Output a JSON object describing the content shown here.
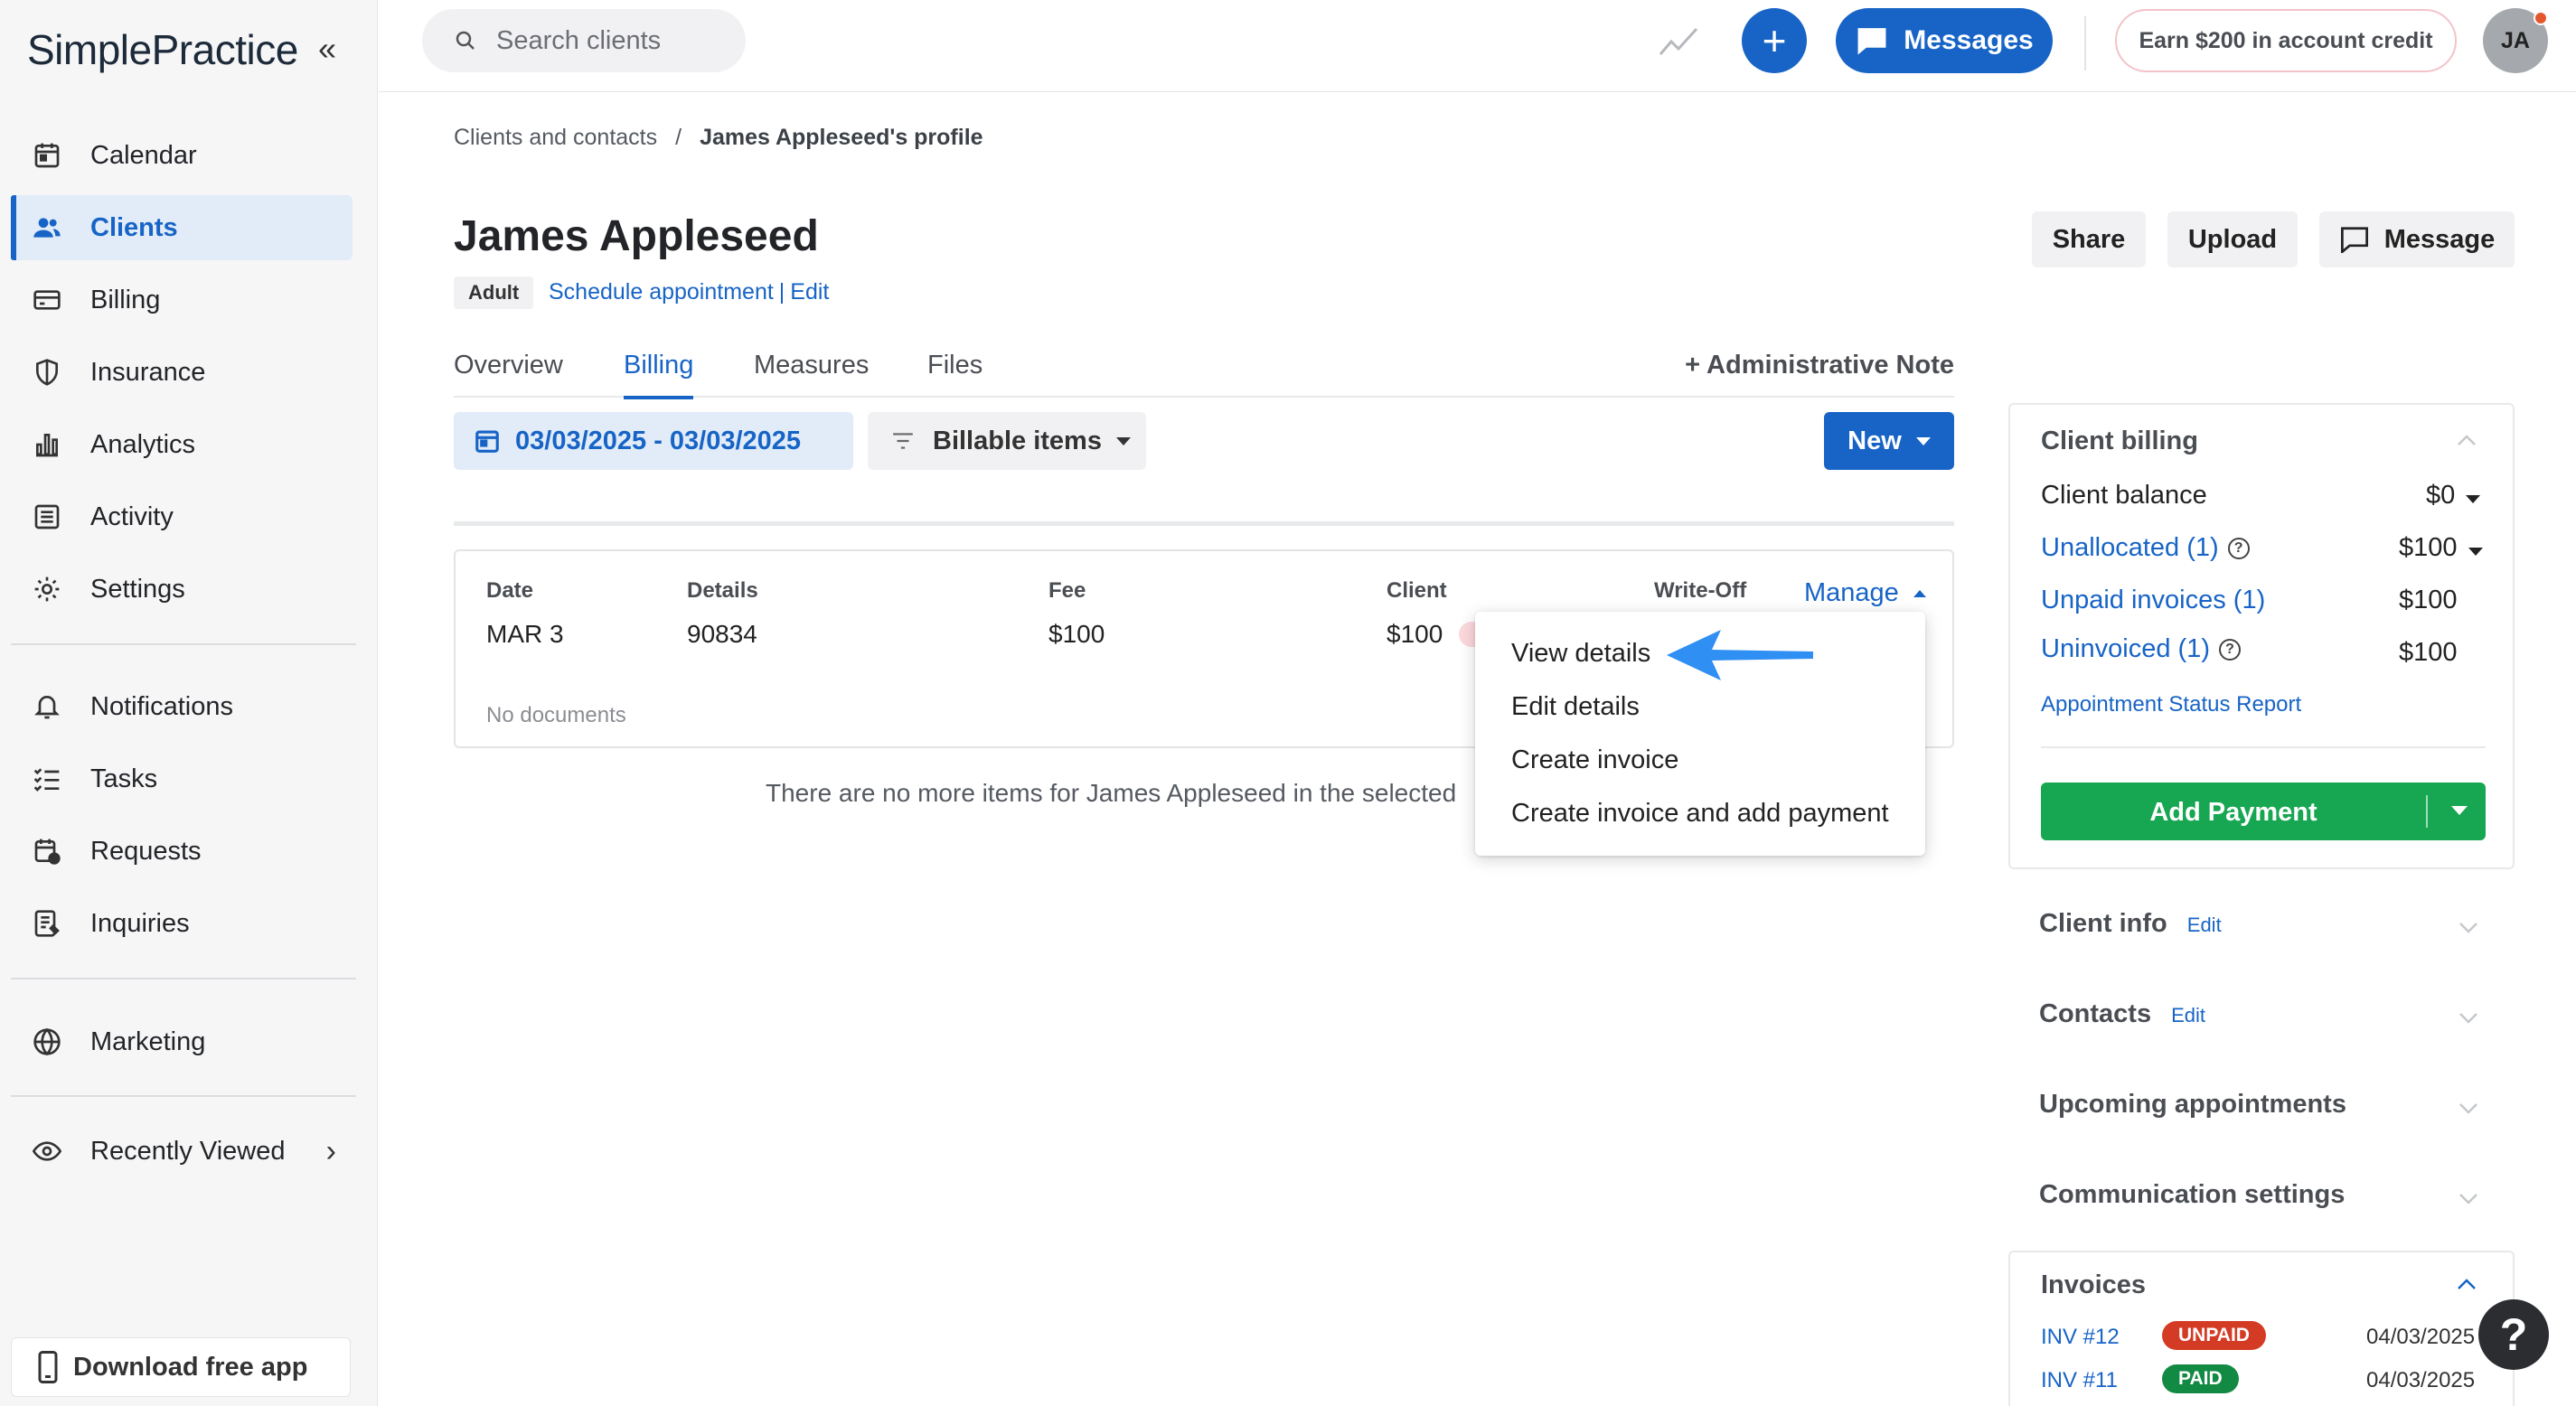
{
  "app": {
    "logo_text": "SimplePractice",
    "collapse_icon": "double-chevron-left-icon"
  },
  "sidebar": {
    "items": [
      {
        "label": "Calendar",
        "icon": "calendar-icon",
        "active": false
      },
      {
        "label": "Clients",
        "icon": "users-icon",
        "active": true
      },
      {
        "label": "Billing",
        "icon": "credit-card-icon",
        "active": false
      },
      {
        "label": "Insurance",
        "icon": "shield-icon",
        "active": false
      },
      {
        "label": "Analytics",
        "icon": "bar-chart-icon",
        "active": false
      },
      {
        "label": "Activity",
        "icon": "list-icon",
        "active": false
      },
      {
        "label": "Settings",
        "icon": "gear-icon",
        "active": false
      },
      {
        "label": "Notifications",
        "icon": "bell-icon",
        "active": false
      },
      {
        "label": "Tasks",
        "icon": "checklist-icon",
        "active": false
      },
      {
        "label": "Requests",
        "icon": "calendar-plus-icon",
        "active": false
      },
      {
        "label": "Inquiries",
        "icon": "document-list-icon",
        "active": false
      },
      {
        "label": "Marketing",
        "icon": "globe-icon",
        "active": false
      },
      {
        "label": "Recently Viewed",
        "icon": "eye-icon",
        "active": false
      }
    ],
    "download_app": "Download free app"
  },
  "topbar": {
    "search_placeholder": "Search clients",
    "messages_label": "Messages",
    "earn_label": "Earn $200 in account credit",
    "avatar_initials": "JA"
  },
  "breadcrumb": {
    "parent": "Clients and contacts",
    "separator": "/",
    "current": "James Appleseed's profile"
  },
  "client": {
    "name": "James Appleseed",
    "tag": "Adult",
    "schedule_link": "Schedule appointment",
    "link_sep": "|",
    "edit_link": "Edit"
  },
  "header_buttons": {
    "share": "Share",
    "upload": "Upload",
    "message": "Message"
  },
  "tabs": [
    {
      "label": "Overview",
      "active": false
    },
    {
      "label": "Billing",
      "active": true
    },
    {
      "label": "Measures",
      "active": false
    },
    {
      "label": "Files",
      "active": false
    }
  ],
  "admin_note": "+ Administrative Note",
  "filters": {
    "date_range": "03/03/2025 - 03/03/2025",
    "billable_items": "Billable items",
    "new_button": "New"
  },
  "billing_item": {
    "columns": {
      "date": "Date",
      "details": "Details",
      "fee": "Fee",
      "client": "Client",
      "write_off": "Write-Off",
      "manage": "Manage"
    },
    "values": {
      "date": "MAR 3",
      "details": "90834",
      "fee": "$100",
      "client": "$100"
    },
    "no_documents": "No documents"
  },
  "manage_menu": [
    "View details",
    "Edit details",
    "Create invoice",
    "Create invoice and add payment"
  ],
  "no_more_items": "There are no more items for James Appleseed in the selected",
  "client_billing": {
    "title": "Client billing",
    "balance_label": "Client balance",
    "balance_value": "$0",
    "unallocated_label": "Unallocated (1)",
    "unallocated_value": "$100",
    "unpaid_label": "Unpaid invoices (1)",
    "unpaid_value": "$100",
    "uninvoiced_label": "Uninvoiced (1)",
    "uninvoiced_value": "$100",
    "report_link": "Appointment Status Report",
    "add_payment": "Add Payment"
  },
  "sections": [
    {
      "title": "Client info",
      "edit": "Edit"
    },
    {
      "title": "Contacts",
      "edit": "Edit"
    },
    {
      "title": "Upcoming appointments",
      "edit": ""
    },
    {
      "title": "Communication settings",
      "edit": ""
    }
  ],
  "invoices": {
    "title": "Invoices",
    "rows": [
      {
        "number": "INV #12",
        "status": "UNPAID",
        "date": "04/03/2025"
      },
      {
        "number": "INV #11",
        "status": "PAID",
        "date": "04/03/2025"
      }
    ]
  },
  "help": "?",
  "colors": {
    "brand_blue": "#1764c6",
    "green": "#17a652",
    "unpaid_red": "#d33b25",
    "paid_green": "#138a43"
  }
}
